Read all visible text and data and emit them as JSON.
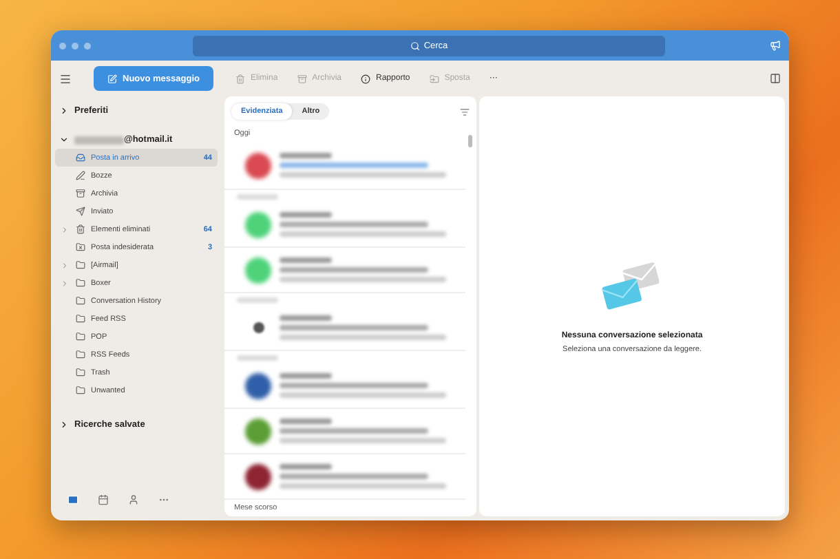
{
  "window": {
    "search_placeholder": "Cerca"
  },
  "toolbar": {
    "new_message": "Nuovo messaggio",
    "actions": [
      {
        "label": "Elimina",
        "disabled": true
      },
      {
        "label": "Archivia",
        "disabled": true
      },
      {
        "label": "Rapporto",
        "disabled": false
      },
      {
        "label": "Sposta",
        "disabled": true
      }
    ],
    "more": "···"
  },
  "sidebar": {
    "favorites": {
      "label": "Preferiti",
      "expanded": false
    },
    "account": {
      "label": "@hotmail.it",
      "expanded": true
    },
    "folders": [
      {
        "label": "Posta in arrivo",
        "count": "44",
        "selected": true,
        "expandable": false
      },
      {
        "label": "Bozze",
        "selected": false,
        "expandable": false
      },
      {
        "label": "Archivia",
        "selected": false,
        "expandable": false
      },
      {
        "label": "Inviato",
        "selected": false,
        "expandable": false
      },
      {
        "label": "Elementi eliminati",
        "count": "64",
        "selected": false,
        "expandable": true
      },
      {
        "label": "Posta indesiderata",
        "count": "3",
        "selected": false,
        "expandable": false
      },
      {
        "label": "[Airmail]",
        "selected": false,
        "expandable": true
      },
      {
        "label": "Boxer",
        "selected": false,
        "expandable": true
      },
      {
        "label": "Conversation History",
        "selected": false,
        "expandable": false
      },
      {
        "label": "Feed RSS",
        "selected": false,
        "expandable": false
      },
      {
        "label": "POP",
        "selected": false,
        "expandable": false
      },
      {
        "label": "RSS Feeds",
        "selected": false,
        "expandable": false
      },
      {
        "label": "Trash",
        "selected": false,
        "expandable": false
      },
      {
        "label": "Unwanted",
        "selected": false,
        "expandable": false
      }
    ],
    "saved_searches": {
      "label": "Ricerche salvate",
      "expanded": false
    },
    "nav": [
      {
        "selected": true
      },
      {
        "selected": false
      },
      {
        "selected": false
      },
      {
        "selected": false
      }
    ]
  },
  "message_list": {
    "tabs": [
      {
        "label": "Evidenziata",
        "selected": true
      },
      {
        "label": "Altro",
        "selected": false
      }
    ],
    "groups": [
      {
        "label": "Oggi",
        "messages": [
          {
            "kind": "avatar",
            "color": "#d94a52",
            "unread": true
          }
        ]
      },
      {
        "messages": [
          {
            "kind": "avatar",
            "color": "#4ed37a",
            "unread": false
          },
          {
            "kind": "avatar",
            "color": "#4ed37a",
            "unread": false
          }
        ]
      },
      {
        "messages": [
          {
            "kind": "logo",
            "unread": false
          }
        ]
      },
      {
        "messages": [
          {
            "kind": "avatar",
            "color": "#2f5fa8",
            "unread": false
          },
          {
            "kind": "avatar",
            "color": "#5a9e35",
            "unread": false
          },
          {
            "kind": "avatar",
            "color": "#8e2432",
            "unread": false
          }
        ]
      },
      {
        "label": "Mese scorso"
      }
    ]
  },
  "reading_pane": {
    "title": "Nessuna conversazione selezionata",
    "subtitle": "Seleziona una conversazione da leggere."
  }
}
